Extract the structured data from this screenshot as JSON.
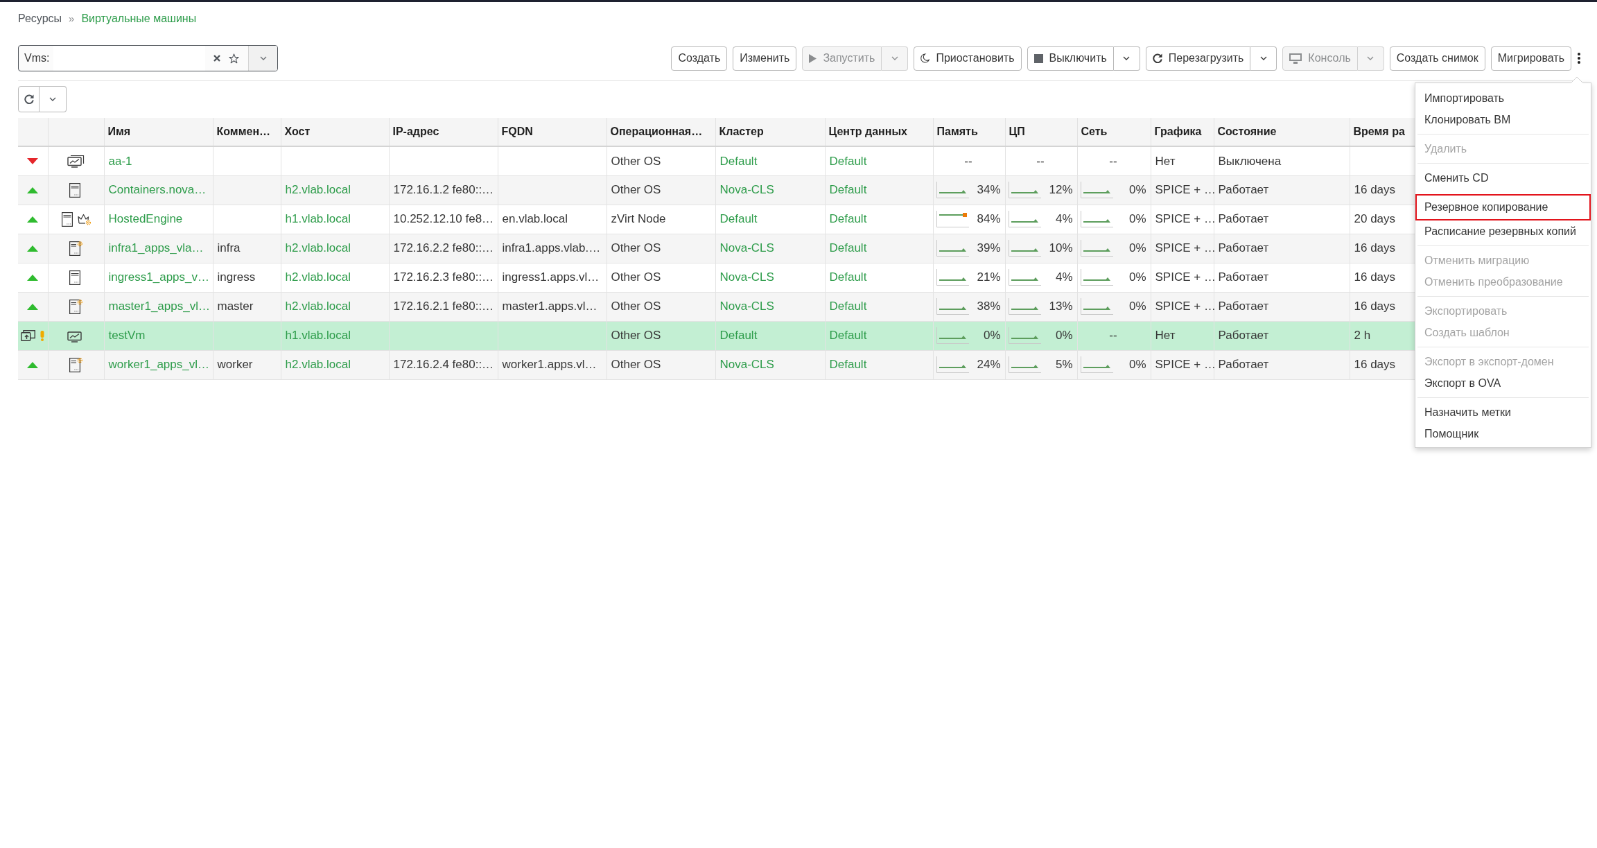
{
  "breadcrumb": {
    "items": [
      {
        "label": "Ресурсы",
        "current": false
      },
      {
        "label": "Виртуальные машины",
        "current": true
      }
    ],
    "separator": "»"
  },
  "search": {
    "prefix": "Vms:"
  },
  "toolbar": {
    "buttons": [
      {
        "label": "Создать",
        "kind": "plain",
        "disabled": false
      },
      {
        "label": "Изменить",
        "kind": "plain",
        "disabled": false
      },
      {
        "label": "Запустить",
        "kind": "split",
        "disabled": true
      },
      {
        "label": "Приостановить",
        "kind": "plain",
        "disabled": false
      },
      {
        "label": "Выключить",
        "kind": "split",
        "disabled": false
      },
      {
        "label": "Перезагрузить",
        "kind": "split",
        "disabled": false
      },
      {
        "label": "Консоль",
        "kind": "split",
        "disabled": true
      },
      {
        "label": "Создать снимок",
        "kind": "plain",
        "disabled": false
      },
      {
        "label": "Мигрировать",
        "kind": "plain",
        "disabled": false
      }
    ]
  },
  "table": {
    "columns": [
      {
        "kind": "status"
      },
      {
        "kind": "type"
      },
      {
        "kind": "text",
        "label": "Имя"
      },
      {
        "kind": "text",
        "label": "Коммен…"
      },
      {
        "kind": "text",
        "label": "Хост"
      },
      {
        "kind": "text",
        "label": "IP-адрес"
      },
      {
        "kind": "text",
        "label": "FQDN"
      },
      {
        "kind": "text",
        "label": "Операционная…"
      },
      {
        "kind": "text",
        "label": "Кластер"
      },
      {
        "kind": "text",
        "label": "Центр данных"
      },
      {
        "kind": "text",
        "label": "Память"
      },
      {
        "kind": "text",
        "label": "ЦП"
      },
      {
        "kind": "text",
        "label": "Сеть"
      },
      {
        "kind": "text",
        "label": "Графика"
      },
      {
        "kind": "text",
        "label": "Состояние"
      },
      {
        "kind": "text",
        "label": "Время ра"
      }
    ],
    "rows": [
      {
        "status": {
          "kind": "down"
        },
        "vm_icon": {
          "kind": "desktop-pool",
          "gear": false,
          "engine": false
        },
        "selected": false,
        "name": "aa-1",
        "os": "Other OS",
        "cluster": "Default",
        "datacenter": "Default",
        "memory": {
          "kind": "empty",
          "value": "--"
        },
        "cpu": {
          "kind": "empty",
          "value": "--"
        },
        "network": {
          "kind": "empty",
          "value": "--"
        },
        "graphics": "Нет",
        "state": "Выключена"
      },
      {
        "status": {
          "kind": "up"
        },
        "vm_icon": {
          "kind": "server",
          "gear": false,
          "engine": false
        },
        "selected": false,
        "name": "Containers.nova…",
        "host": "h2.vlab.local",
        "ip": "172.16.1.2 fe80::…",
        "os": "Other OS",
        "cluster": "Nova-CLS",
        "datacenter": "Default",
        "memory": {
          "kind": "sparkline",
          "value": "34%",
          "warning": false
        },
        "cpu": {
          "kind": "sparkline",
          "value": "12%",
          "warning": false
        },
        "network": {
          "kind": "sparkline",
          "value": "0%",
          "warning": false
        },
        "graphics": "SPICE + …",
        "state": "Работает",
        "uptime": "16 days"
      },
      {
        "status": {
          "kind": "up"
        },
        "vm_icon": {
          "kind": "server",
          "gear": false,
          "engine": true
        },
        "selected": false,
        "name": "HostedEngine",
        "host": "h1.vlab.local",
        "ip": "10.252.12.10 fe8…",
        "fqdn": "en.vlab.local",
        "os": "zVirt Node",
        "cluster": "Default",
        "datacenter": "Default",
        "memory": {
          "kind": "sparkline",
          "value": "84%",
          "warning": true
        },
        "cpu": {
          "kind": "sparkline",
          "value": "4%",
          "warning": false
        },
        "network": {
          "kind": "sparkline",
          "value": "0%",
          "warning": false
        },
        "graphics": "SPICE + …",
        "state": "Работает",
        "uptime": "20 days"
      },
      {
        "status": {
          "kind": "up"
        },
        "vm_icon": {
          "kind": "server",
          "gear": true,
          "engine": false
        },
        "selected": false,
        "name": "infra1_apps_vla…",
        "comment": "infra",
        "host": "h2.vlab.local",
        "ip": "172.16.2.2 fe80::…",
        "fqdn": "infra1.apps.vlab.…",
        "os": "Other OS",
        "cluster": "Nova-CLS",
        "datacenter": "Default",
        "memory": {
          "kind": "sparkline",
          "value": "39%",
          "warning": false
        },
        "cpu": {
          "kind": "sparkline",
          "value": "10%",
          "warning": false
        },
        "network": {
          "kind": "sparkline",
          "value": "0%",
          "warning": false
        },
        "graphics": "SPICE + …",
        "state": "Работает",
        "uptime": "16 days"
      },
      {
        "status": {
          "kind": "up"
        },
        "vm_icon": {
          "kind": "server",
          "gear": false,
          "engine": false
        },
        "selected": false,
        "name": "ingress1_apps_v…",
        "comment": "ingress",
        "host": "h2.vlab.local",
        "ip": "172.16.2.3 fe80::…",
        "fqdn": "ingress1.apps.vl…",
        "os": "Other OS",
        "cluster": "Nova-CLS",
        "datacenter": "Default",
        "memory": {
          "kind": "sparkline",
          "value": "21%",
          "warning": false
        },
        "cpu": {
          "kind": "sparkline",
          "value": "4%",
          "warning": false
        },
        "network": {
          "kind": "sparkline",
          "value": "0%",
          "warning": false
        },
        "graphics": "SPICE + …",
        "state": "Работает",
        "uptime": "16 days"
      },
      {
        "status": {
          "kind": "up"
        },
        "vm_icon": {
          "kind": "server",
          "gear": true,
          "engine": false
        },
        "selected": false,
        "name": "master1_apps_vl…",
        "comment": "master",
        "host": "h2.vlab.local",
        "ip": "172.16.2.1 fe80::…",
        "fqdn": "master1.apps.vl…",
        "os": "Other OS",
        "cluster": "Nova-CLS",
        "datacenter": "Default",
        "memory": {
          "kind": "sparkline",
          "value": "38%",
          "warning": false
        },
        "cpu": {
          "kind": "sparkline",
          "value": "13%",
          "warning": false
        },
        "network": {
          "kind": "sparkline",
          "value": "0%",
          "warning": false
        },
        "graphics": "SPICE + …",
        "state": "Работает",
        "uptime": "16 days"
      },
      {
        "status": {
          "kind": "busy"
        },
        "vm_icon": {
          "kind": "desktop",
          "gear": false,
          "engine": false
        },
        "selected": true,
        "name": "testVm",
        "host": "h1.vlab.local",
        "os": "Other OS",
        "cluster": "Default",
        "datacenter": "Default",
        "memory": {
          "kind": "sparkline",
          "value": "0%",
          "warning": false
        },
        "cpu": {
          "kind": "sparkline",
          "value": "0%",
          "warning": false
        },
        "network": {
          "kind": "empty",
          "value": "--"
        },
        "graphics": "Нет",
        "state": "Работает",
        "uptime": "2 h"
      },
      {
        "status": {
          "kind": "up"
        },
        "vm_icon": {
          "kind": "server",
          "gear": true,
          "engine": false
        },
        "selected": false,
        "name": "worker1_apps_vl…",
        "comment": "worker",
        "host": "h2.vlab.local",
        "ip": "172.16.2.4 fe80::…",
        "fqdn": "worker1.apps.vl…",
        "os": "Other OS",
        "cluster": "Nova-CLS",
        "datacenter": "Default",
        "memory": {
          "kind": "sparkline",
          "value": "24%",
          "warning": false
        },
        "cpu": {
          "kind": "sparkline",
          "value": "5%",
          "warning": false
        },
        "network": {
          "kind": "sparkline",
          "value": "0%",
          "warning": false
        },
        "graphics": "SPICE + …",
        "state": "Работает",
        "uptime": "16 days"
      }
    ]
  },
  "actions_menu": {
    "expanded": true,
    "groups": [
      {
        "items": [
          {
            "label": "Импортировать",
            "disabled": false,
            "highlighted": false
          },
          {
            "label": "Клонировать ВМ",
            "disabled": false,
            "highlighted": false
          }
        ]
      },
      {
        "items": [
          {
            "label": "Удалить",
            "disabled": true,
            "highlighted": false
          }
        ]
      },
      {
        "items": [
          {
            "label": "Сменить CD",
            "disabled": false,
            "highlighted": false
          },
          {
            "label": "Резервное копирование",
            "disabled": false,
            "highlighted": true
          },
          {
            "label": "Расписание резервных копий",
            "disabled": false,
            "highlighted": false
          }
        ]
      },
      {
        "items": [
          {
            "label": "Отменить миграцию",
            "disabled": true,
            "highlighted": false
          },
          {
            "label": "Отменить преобразование",
            "disabled": true,
            "highlighted": false
          }
        ]
      },
      {
        "items": [
          {
            "label": "Экспортировать",
            "disabled": true,
            "highlighted": false
          },
          {
            "label": "Создать шаблон",
            "disabled": true,
            "highlighted": false
          }
        ]
      },
      {
        "items": [
          {
            "label": "Экспорт в экспорт-домен",
            "disabled": true,
            "highlighted": false
          },
          {
            "label": "Экспорт в OVA",
            "disabled": false,
            "highlighted": false
          }
        ]
      },
      {
        "items": [
          {
            "label": "Назначить метки",
            "disabled": false,
            "highlighted": false
          },
          {
            "label": "Помощник",
            "disabled": false,
            "highlighted": false
          }
        ]
      }
    ]
  }
}
